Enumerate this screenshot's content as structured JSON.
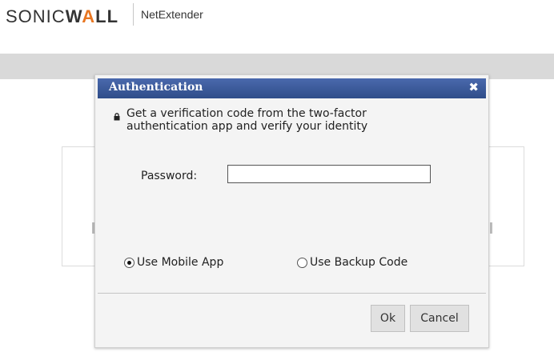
{
  "header": {
    "logo_part1": "SONIC",
    "logo_part2_w": "W",
    "logo_part2_a": "A",
    "logo_part2_ll": "LL",
    "product": "NetExtender"
  },
  "dialog": {
    "title": "Authentication",
    "close_glyph": "✖",
    "message": "Get a verification code from the two-factor authentication app and verify your identity",
    "password_label": "Password:",
    "password_value": "",
    "radio_mobile_label": "Use Mobile App",
    "radio_mobile_selected": true,
    "radio_backup_label": "Use Backup Code",
    "radio_backup_selected": false,
    "ok_label": "Ok",
    "cancel_label": "Cancel"
  },
  "colors": {
    "titlebar": "#3b5998",
    "logo_accent": "#e87722",
    "band": "#d9d9d9"
  },
  "icons": {
    "message": "lock-icon",
    "close": "close-icon"
  }
}
